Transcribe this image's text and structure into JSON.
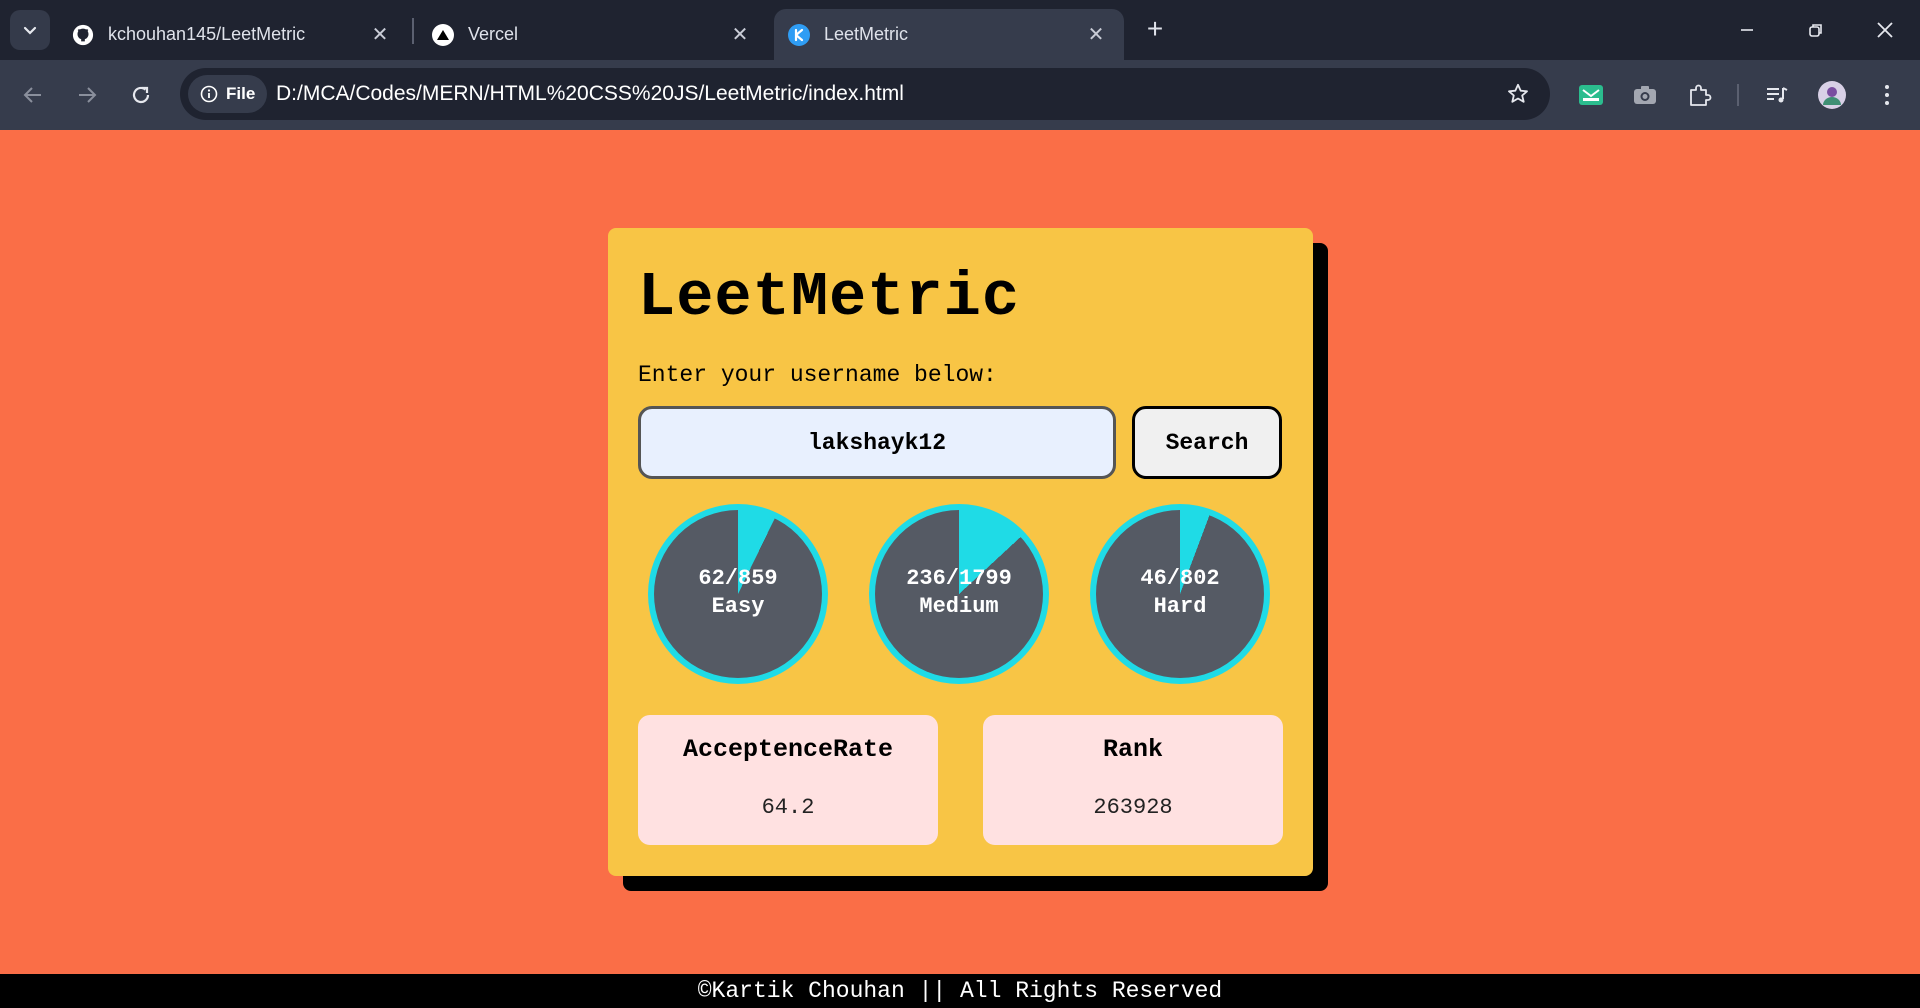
{
  "browser": {
    "tabs": [
      {
        "title": "kchouhan145/LeetMetric",
        "icon": "github-icon"
      },
      {
        "title": "Vercel",
        "icon": "vercel-icon"
      },
      {
        "title": "LeetMetric",
        "icon": "leetmetric-icon",
        "active": true
      }
    ],
    "address": {
      "chip": "File",
      "url": "D:/MCA/Codes/MERN/HTML%20CSS%20JS/LeetMetric/index.html"
    }
  },
  "app": {
    "title": "LeetMetric",
    "prompt": "Enter your username below:",
    "username_value": "lakshayk12",
    "search_label": "Search",
    "progress": [
      {
        "solved_text": "62/859",
        "level": "Easy",
        "fraction": 0.072
      },
      {
        "solved_text": "236/1799",
        "level": "Medium",
        "fraction": 0.131
      },
      {
        "solved_text": "46/802",
        "level": "Hard",
        "fraction": 0.057
      }
    ],
    "stats": [
      {
        "label": "AcceptenceRate",
        "value": "64.2"
      },
      {
        "label": "Rank",
        "value": "263928"
      }
    ]
  },
  "footer": "©Kartik Chouhan || All Rights Reserved",
  "colors": {
    "background": "#fa6e47",
    "card": "#f8c545",
    "progress": "#1fdbe6",
    "circle": "#555a64",
    "stat_card": "#ffe1e1"
  }
}
